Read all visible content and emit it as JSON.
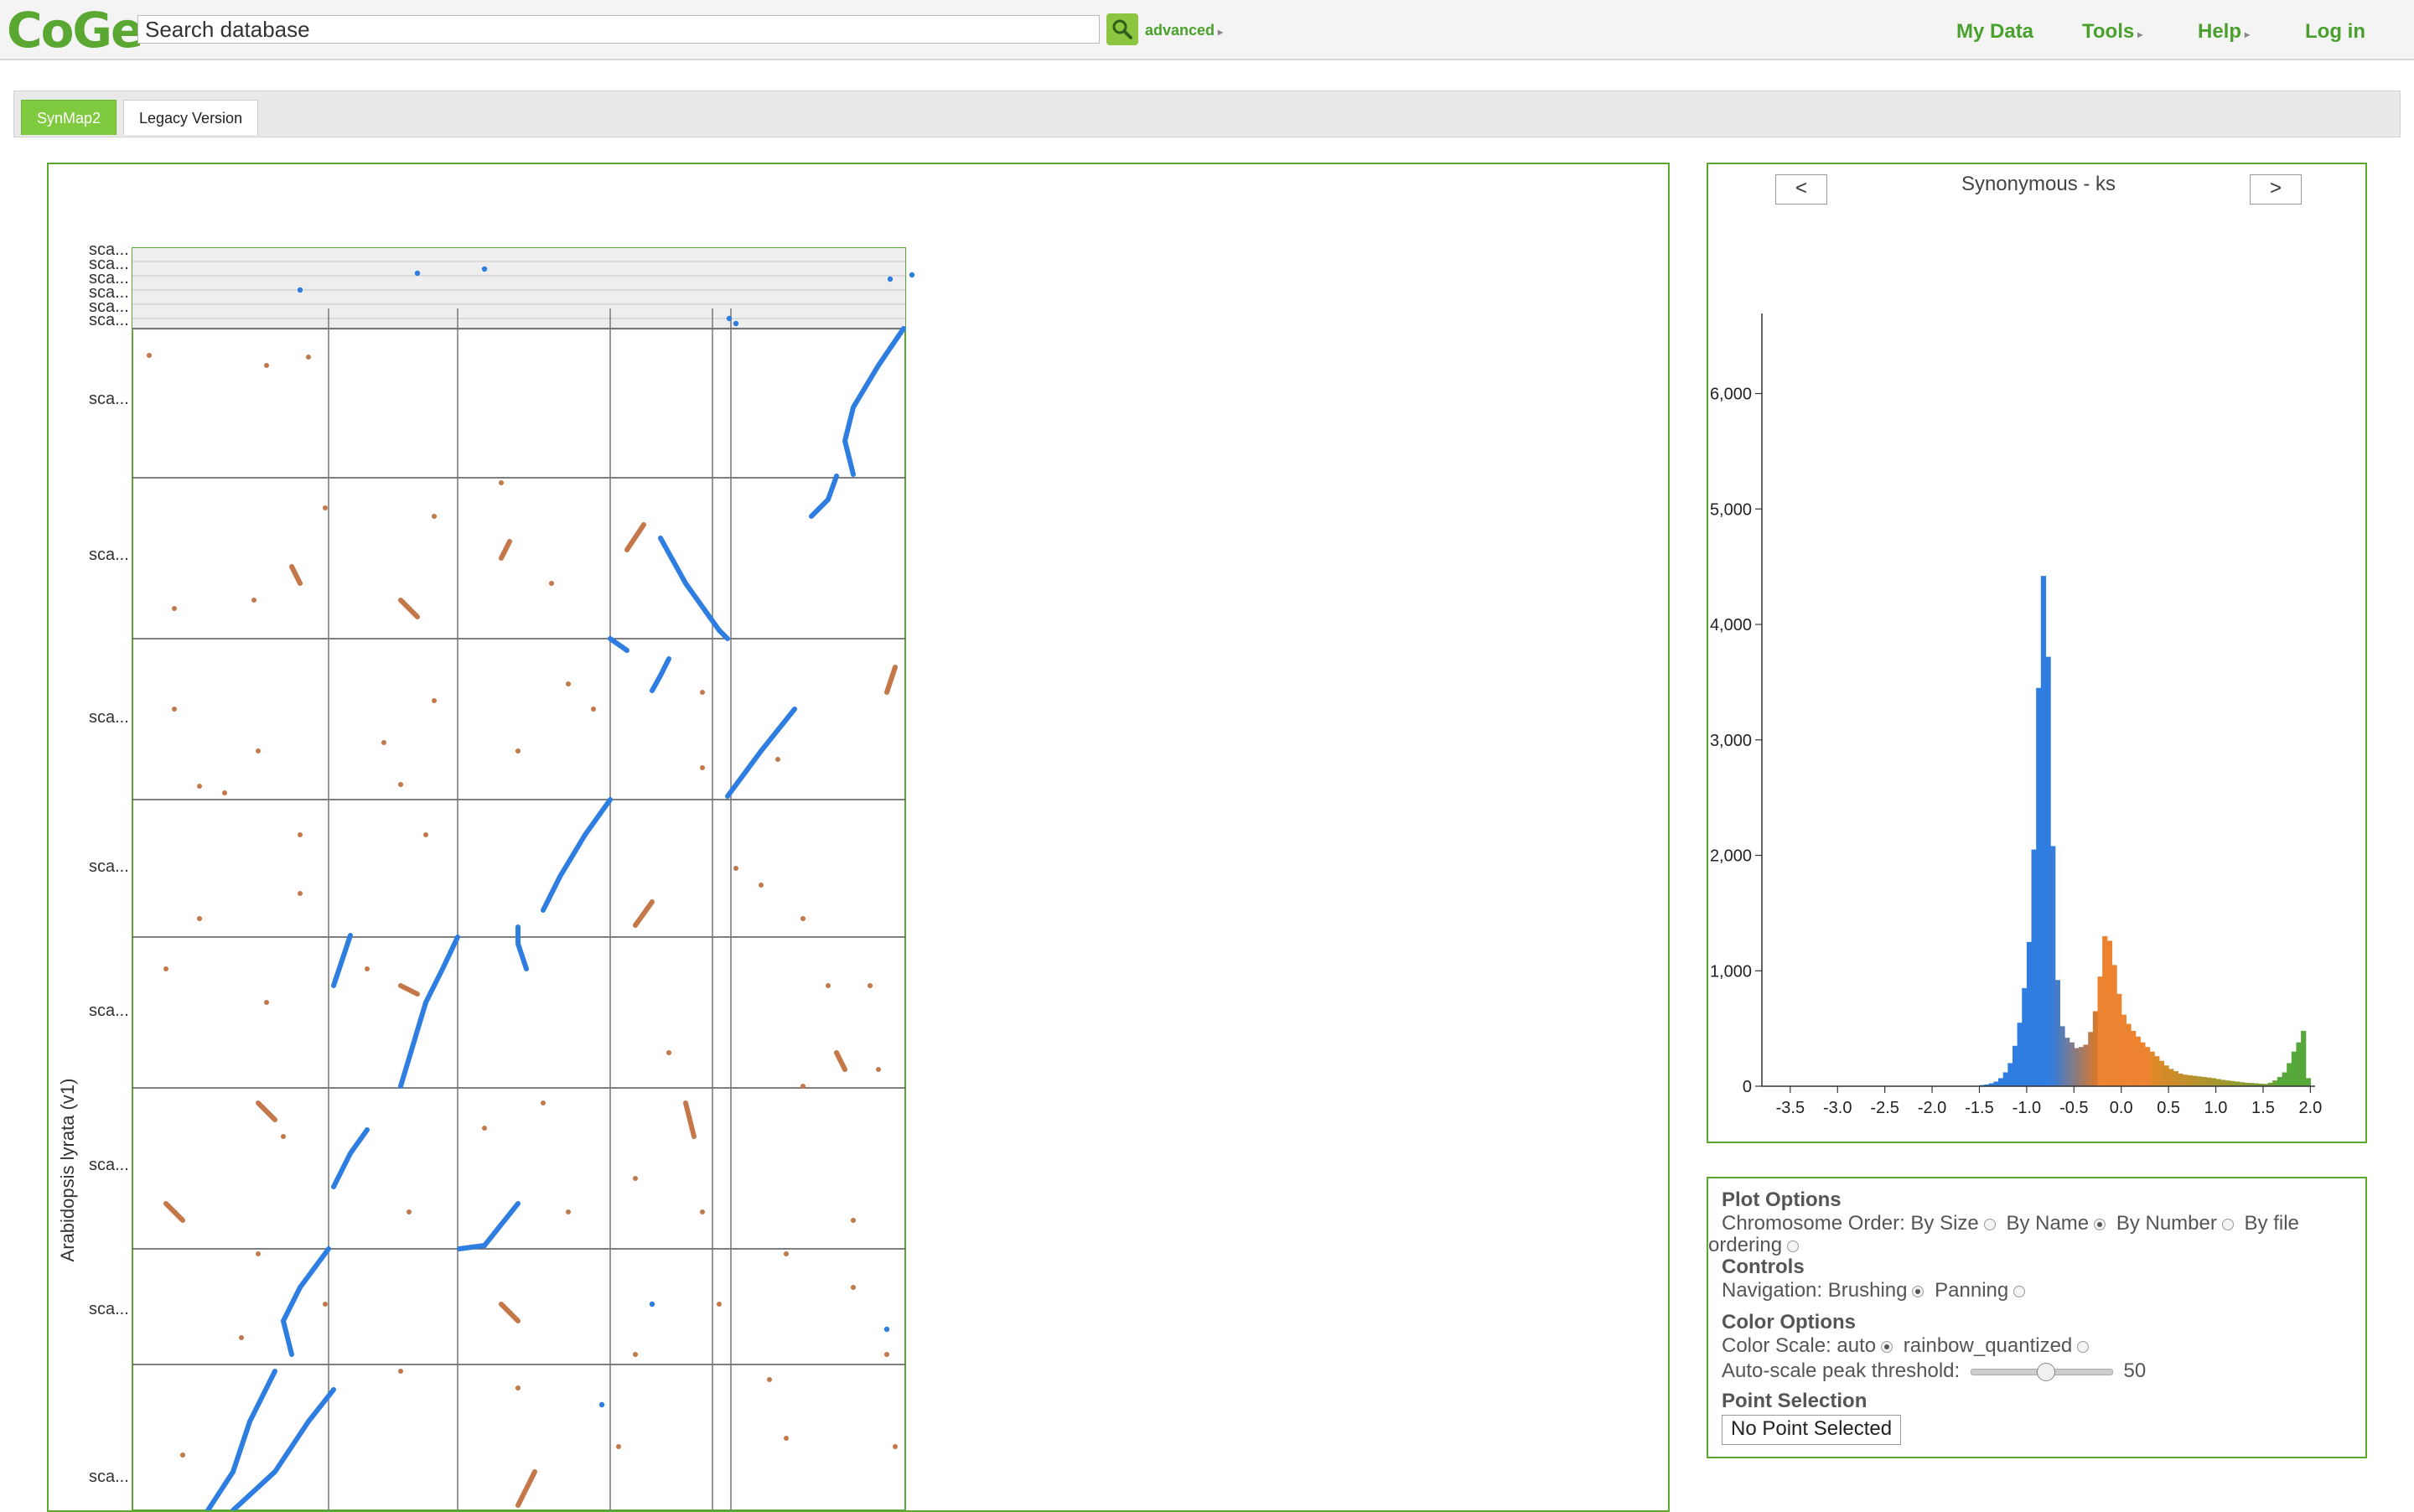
{
  "header": {
    "logo": "CoGe",
    "search_placeholder": "Search database",
    "advanced": "advanced",
    "nav": [
      "My Data",
      "Tools",
      "Help",
      "Log in"
    ]
  },
  "tabs": [
    "SynMap2",
    "Legacy Version"
  ],
  "dotplot": {
    "y_axis_label": "Arabidopsis lyrata (v1)",
    "row_labels": [
      "sca...",
      "sca...",
      "sca...",
      "sca...",
      "sca...",
      "sca...",
      "sca...",
      "sca...",
      "sca...",
      "sca...",
      "sca...",
      "sca...",
      "sca...",
      "sca..."
    ],
    "colors": {
      "low": "#2e7de0",
      "mid": "#c4784a",
      "high": "#5aa832"
    }
  },
  "histogram": {
    "prev": "<",
    "next": ">",
    "title": "Synonymous - ks",
    "chart_data": {
      "type": "bar",
      "title": "Synonymous - ks",
      "x_ticks": [
        "-3.5",
        "-3.0",
        "-2.5",
        "-2.0",
        "-1.5",
        "-1.0",
        "-0.5",
        "0.0",
        "0.5",
        "1.0",
        "1.5",
        "2.0"
      ],
      "y_ticks": [
        "0",
        "1,000",
        "2,000",
        "3,000",
        "4,000",
        "5,000",
        "6,000"
      ],
      "xlim": [
        -3.8,
        2.05
      ],
      "ylim": [
        0,
        6650
      ],
      "bin_width": 0.05,
      "bins_start": [
        -1.5,
        -1.45,
        -1.4,
        -1.35,
        -1.3,
        -1.25,
        -1.2,
        -1.15,
        -1.1,
        -1.05,
        -1.0,
        -0.95,
        -0.9,
        -0.85,
        -0.8,
        -0.75,
        -0.7,
        -0.65,
        -0.6,
        -0.55,
        -0.5,
        -0.45,
        -0.4,
        -0.35,
        -0.3,
        -0.25,
        -0.2,
        -0.15,
        -0.1,
        -0.05,
        0.0,
        0.05,
        0.1,
        0.15,
        0.2,
        0.25,
        0.3,
        0.35,
        0.4,
        0.45,
        0.5,
        0.55,
        0.6,
        0.65,
        0.7,
        0.75,
        0.8,
        0.85,
        0.9,
        0.95,
        1.0,
        1.05,
        1.1,
        1.15,
        1.2,
        1.25,
        1.3,
        1.35,
        1.4,
        1.45,
        1.5,
        1.55,
        1.6,
        1.65,
        1.7,
        1.75,
        1.8,
        1.85,
        1.9,
        1.95
      ],
      "values": [
        10,
        15,
        25,
        40,
        70,
        120,
        200,
        350,
        550,
        850,
        1250,
        2050,
        3450,
        4420,
        3720,
        2080,
        920,
        520,
        420,
        380,
        330,
        340,
        360,
        470,
        650,
        950,
        1300,
        1260,
        1050,
        800,
        620,
        540,
        480,
        430,
        380,
        340,
        300,
        260,
        220,
        180,
        150,
        130,
        110,
        100,
        95,
        90,
        85,
        80,
        75,
        70,
        62,
        55,
        50,
        45,
        40,
        35,
        30,
        28,
        25,
        22,
        20,
        30,
        50,
        80,
        120,
        200,
        300,
        380,
        480,
        70
      ]
    }
  },
  "options": {
    "plot_options": "Plot Options",
    "chromosome_order": "Chromosome Order:",
    "by_size": "By Size",
    "by_name": "By Name",
    "by_number": "By Number",
    "by_file": "By file",
    "ordering": "ordering",
    "controls": "Controls",
    "navigation": "Navigation:",
    "brushing": "Brushing",
    "panning": "Panning",
    "color_options": "Color Options",
    "color_scale": "Color Scale:",
    "auto": "auto",
    "rainbow": "rainbow_quantized",
    "auto_scale": "Auto-scale peak threshold:",
    "threshold": "50",
    "point_selection": "Point Selection",
    "no_point": "No Point Selected"
  }
}
